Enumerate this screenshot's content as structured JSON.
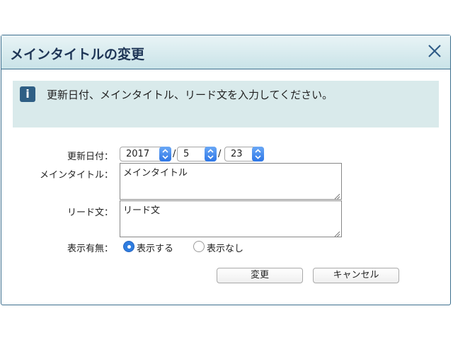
{
  "dialog": {
    "title": "メインタイトルの変更",
    "info_text": "更新日付、メインタイトル、リード文を入力してください。"
  },
  "form": {
    "date_label": "更新日付：",
    "year": "2017",
    "month": "5",
    "day": "23",
    "date_separator": "/",
    "main_title_label": "メインタイトル：",
    "main_title_value": "メインタイトル",
    "lead_label": "リード文：",
    "lead_value": "リード文",
    "display_label": "表示有無：",
    "display_on": "表示する",
    "display_off": "表示なし",
    "display_selected": "表示する"
  },
  "buttons": {
    "change": "変更",
    "cancel": "キャンセル"
  },
  "colors": {
    "title_text": "#1e3556",
    "accent": "#2f7de0",
    "info_bg": "#d9eaeb"
  }
}
